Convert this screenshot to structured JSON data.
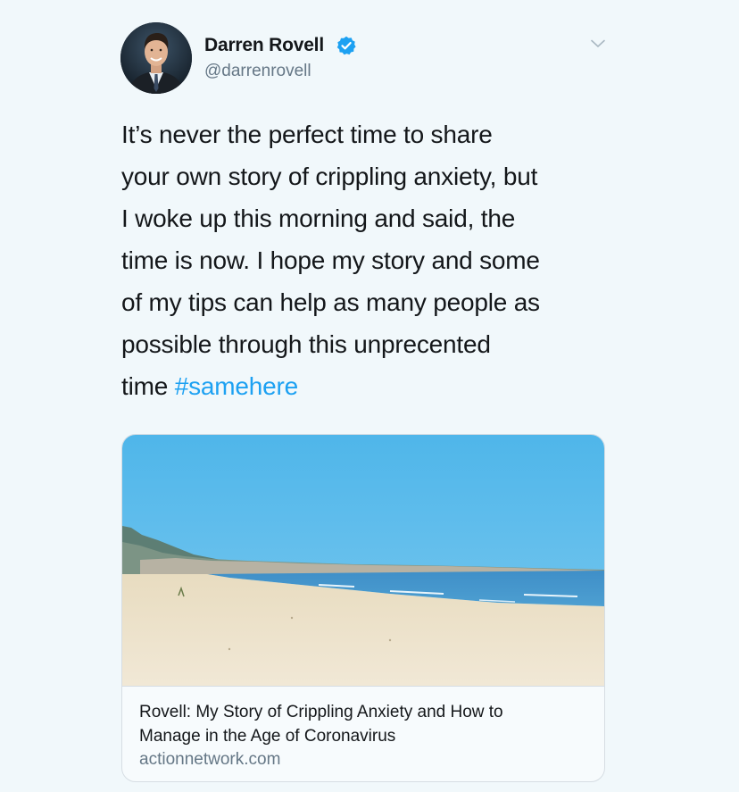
{
  "tweet": {
    "author": {
      "name": "Darren Rovell",
      "handle": "@darrenrovell",
      "verified_icon": "verified-badge-icon",
      "avatar_icon": "avatar-photo"
    },
    "menu_icon": "chevron-down-icon",
    "text_lines": [
      "It’s never the perfect time to share",
      "your own story of crippling anxiety, but",
      "I woke up this morning and said, the",
      "time is now. I hope my story and some",
      "of my tips can help as many people as",
      "possible through this unprecented"
    ],
    "last_line_text": "time",
    "hashtag": "#samehere",
    "card": {
      "image_icon": "beach-photo",
      "title_line1": "Rovell: My Story of Crippling Anxiety and How to",
      "title_line2": "Manage in the Age of Coronavirus",
      "domain": "actionnetwork.com"
    }
  },
  "colors": {
    "background": "#f1f8fb",
    "text": "#14171a",
    "secondary_text": "#657786",
    "link": "#1da1f2",
    "verified": "#1da1f2",
    "card_border": "#d6dde3"
  }
}
